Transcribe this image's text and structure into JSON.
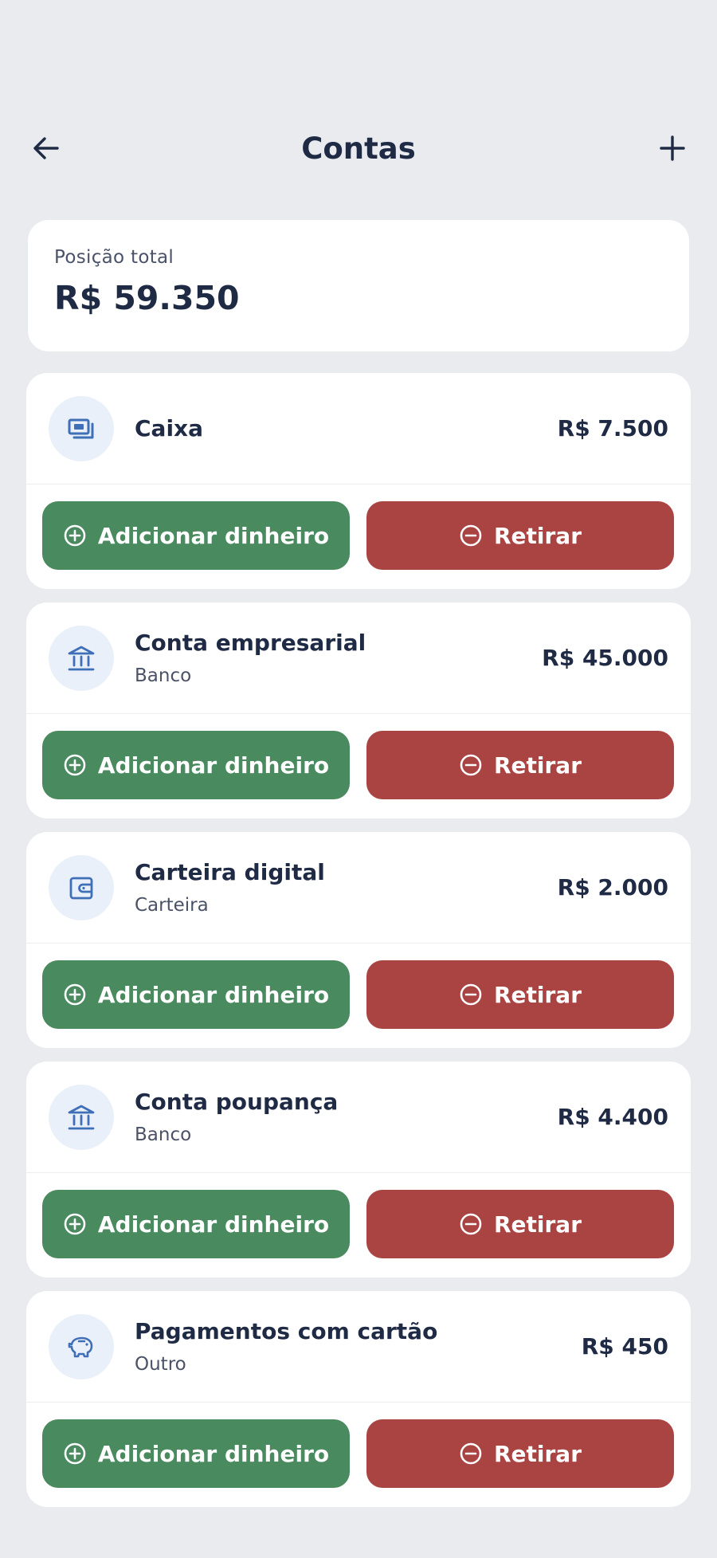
{
  "header": {
    "title": "Contas"
  },
  "total": {
    "label": "Posição total",
    "value": "R$ 59.350"
  },
  "accounts": [
    {
      "name": "Caixa",
      "type": "",
      "balance": "R$ 7.500",
      "icon": "cash-icon",
      "add_label": "Adicionar dinheiro",
      "withdraw_label": "Retirar"
    },
    {
      "name": "Conta empresarial",
      "type": "Banco",
      "balance": "R$ 45.000",
      "icon": "bank-icon",
      "add_label": "Adicionar dinheiro",
      "withdraw_label": "Retirar"
    },
    {
      "name": "Carteira digital",
      "type": "Carteira",
      "balance": "R$ 2.000",
      "icon": "wallet-icon",
      "add_label": "Adicionar dinheiro",
      "withdraw_label": "Retirar"
    },
    {
      "name": "Conta poupança",
      "type": "Banco",
      "balance": "R$ 4.400",
      "icon": "bank-icon",
      "add_label": "Adicionar dinheiro",
      "withdraw_label": "Retirar"
    },
    {
      "name": "Pagamentos com cartão",
      "type": "Outro",
      "balance": "R$ 450",
      "icon": "piggy-bank-icon",
      "add_label": "Adicionar dinheiro",
      "withdraw_label": "Retirar"
    }
  ],
  "colors": {
    "add": "#4a8a5f",
    "withdraw": "#aa4442",
    "icon_bg": "#eaf0fa",
    "icon_fg": "#3f6fb6"
  }
}
